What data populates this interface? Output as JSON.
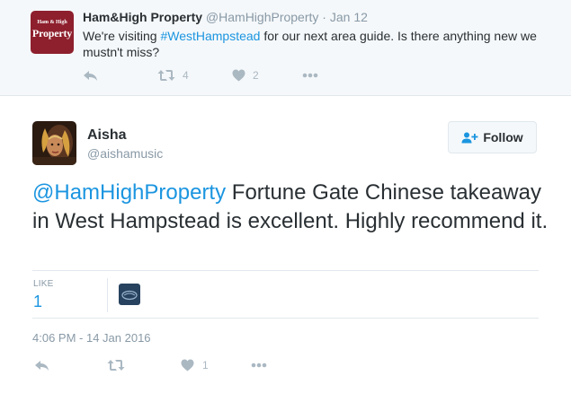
{
  "parent_tweet": {
    "avatar_text_small": "Ham & High",
    "avatar_text_big": "Property",
    "name": "Ham&High Property",
    "handle": "@HamHighProperty",
    "separator": "·",
    "date": "Jan 12",
    "text_before": "We're visiting ",
    "hashtag": "#WestHampstead",
    "text_after": " for our next area guide. Is there anything new we mustn't miss?",
    "retweets": "4",
    "likes": "2"
  },
  "main_tweet": {
    "name": "Aisha",
    "handle": "@aishamusic",
    "follow_label": "Follow",
    "mention": "@HamHighProperty",
    "text": " Fortune Gate Chinese takeaway in West Hampstead is excellent. Highly recommend it.",
    "like_label": "LIKE",
    "like_count": "1",
    "timestamp": "4:06 PM - 14 Jan 2016",
    "likes": "1"
  },
  "colors": {
    "link": "#1b95e0",
    "muted": "#8899a6",
    "icon": "#aab8c2",
    "brand_avatar": "#8e1f2d"
  },
  "icons": [
    "reply-icon",
    "retweet-icon",
    "heart-icon",
    "more-icon",
    "follow-user-icon"
  ]
}
